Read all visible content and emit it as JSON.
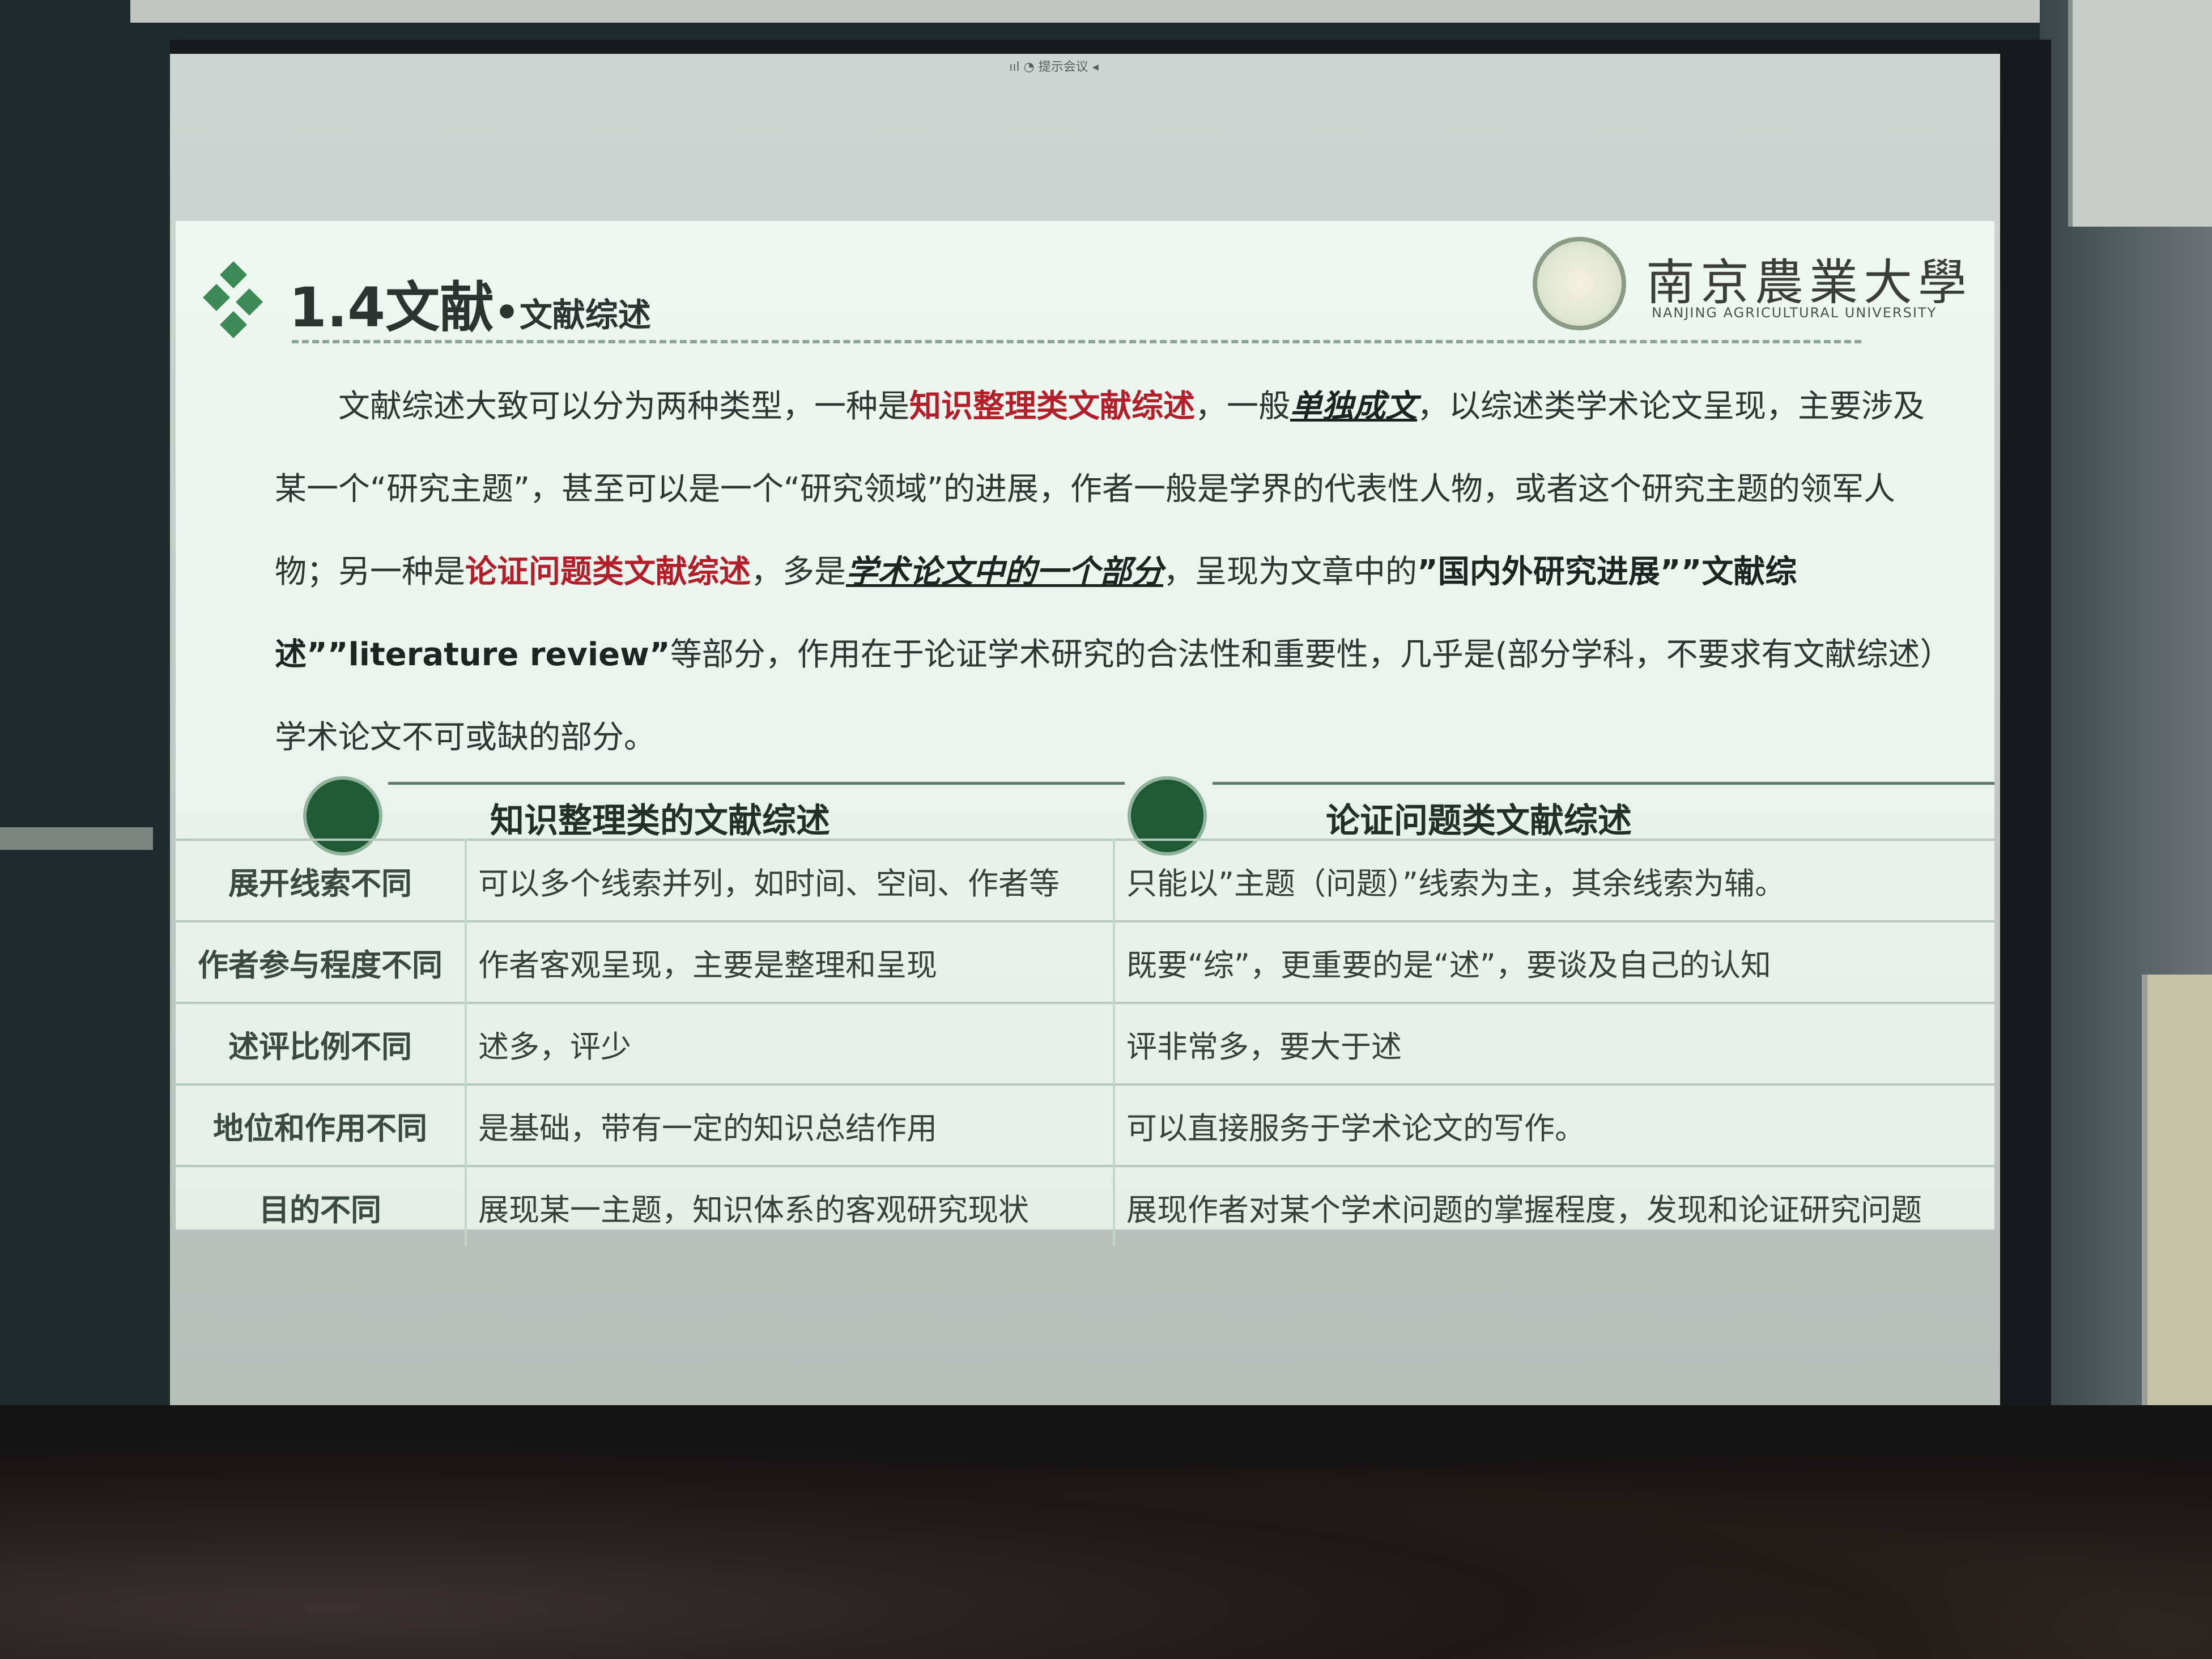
{
  "screen": {
    "status_text": "ııl ◔ 提示会议 ◂"
  },
  "slide": {
    "title_main": "1.4文献",
    "title_dot": "•",
    "title_sub": "文献综述",
    "logo": {
      "name": "南京農業大學",
      "subtitle": "NANJING AGRICULTURAL UNIVERSITY"
    },
    "paragraph": {
      "p1": "文献综述大致可以分为两种类型，一种是",
      "r1": "知识整理类文献综述",
      "p2": "，一般",
      "e1": "单独成文",
      "p3": "，以综述类学术论文呈现，主要涉及某一个“研究主题”，甚至可以是一个“研究领域”的进展，作者一般是学界的代表性人物，或者这个研究主题的领军人物；另一种是",
      "r2": "论证问题类文献综述",
      "p4": "，多是",
      "e2": "学术论文中的一个部分",
      "p5": "，呈现为文章中的",
      "b1": "”国内外研究进展””文献综述””literature review”",
      "p6": "等部分，作用在于论证学术研究的合法性和重要性，几乎是(部分学科，不要求有文献综述）学术论文不可或缺的部分。"
    },
    "columns": {
      "left_header": "知识整理类的文献综述",
      "right_header": "论证问题类文献综述"
    },
    "table_rows": [
      {
        "aspect": "展开线索不同",
        "left": "可以多个线索并列，如时间、空间、作者等",
        "right": "只能以”主题（问题）”线索为主，其余线索为辅。"
      },
      {
        "aspect": "作者参与程度不同",
        "left": "作者客观呈现，主要是整理和呈现",
        "right": "既要“综”，更重要的是“述”，要谈及自己的认知"
      },
      {
        "aspect": "述评比例不同",
        "left": "述多，评少",
        "right": "评非常多，要大于述"
      },
      {
        "aspect": "地位和作用不同",
        "left": "是基础，带有一定的知识总结作用",
        "right": "可以直接服务于学术论文的写作。"
      },
      {
        "aspect": "目的不同",
        "left": "展现某一主题，知识体系的客观研究现状",
        "right": "展现作者对某个学术问题的掌握程度，发现和论证研究问题"
      }
    ]
  }
}
